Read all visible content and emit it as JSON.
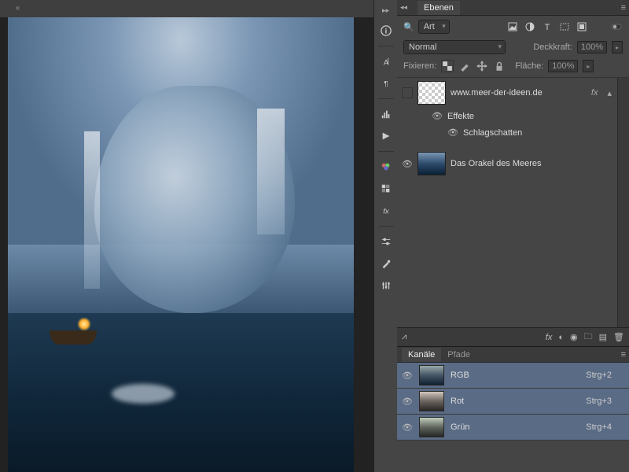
{
  "canvas": {
    "tab_close": "×"
  },
  "panels": {
    "layers": {
      "title": "Ebenen",
      "filter_label": "Art",
      "blend_mode": "Normal",
      "opacity_label": "Deckkraft:",
      "opacity_value": "100%",
      "fill_label": "Fläche:",
      "fill_value": "100%",
      "lock_label": "Fixieren:",
      "items": [
        {
          "name": "www.meer-der-ideen.de",
          "fx": "fx"
        },
        {
          "effects_label": "Effekte"
        },
        {
          "effect_name": "Schlagschatten"
        },
        {
          "name": "Das Orakel des Meeres"
        }
      ]
    },
    "channels": {
      "tab1": "Kanäle",
      "tab2": "Pfade",
      "items": [
        {
          "name": "RGB",
          "shortcut": "Strg+2"
        },
        {
          "name": "Rot",
          "shortcut": "Strg+3"
        },
        {
          "name": "Grün",
          "shortcut": "Strg+4"
        }
      ]
    }
  }
}
